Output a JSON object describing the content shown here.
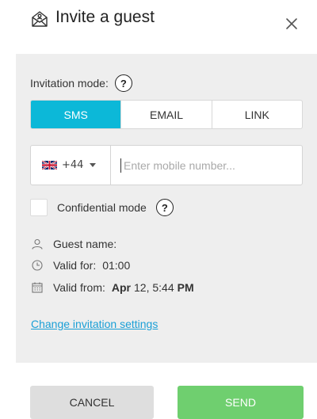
{
  "dialog": {
    "title": "Invite a guest",
    "icon": "guest-invite-envelope-icon"
  },
  "invitation_mode": {
    "label": "Invitation mode:",
    "tabs": [
      {
        "label": "SMS",
        "active": true
      },
      {
        "label": "EMAIL",
        "active": false
      },
      {
        "label": "LINK",
        "active": false
      }
    ]
  },
  "phone": {
    "country_flag": "uk-flag-icon",
    "country_code": "+44",
    "placeholder": "Enter mobile number...",
    "value": ""
  },
  "confidential": {
    "label": "Confidential mode",
    "checked": false
  },
  "guest": {
    "name_label": "Guest name:",
    "name_value": "",
    "valid_for_label": "Valid for:",
    "valid_for_value": "01:00",
    "valid_from_label": "Valid from:",
    "valid_from_date": "Apr",
    "valid_from_rest": "12, 5:44",
    "valid_from_period": "PM"
  },
  "settings_link": "Change invitation settings",
  "actions": {
    "cancel": "CANCEL",
    "send": "SEND"
  },
  "colors": {
    "accent": "#0cb8d8",
    "send": "#6fcf6f",
    "link": "#1a9fd6",
    "panel": "#eeeeee"
  }
}
